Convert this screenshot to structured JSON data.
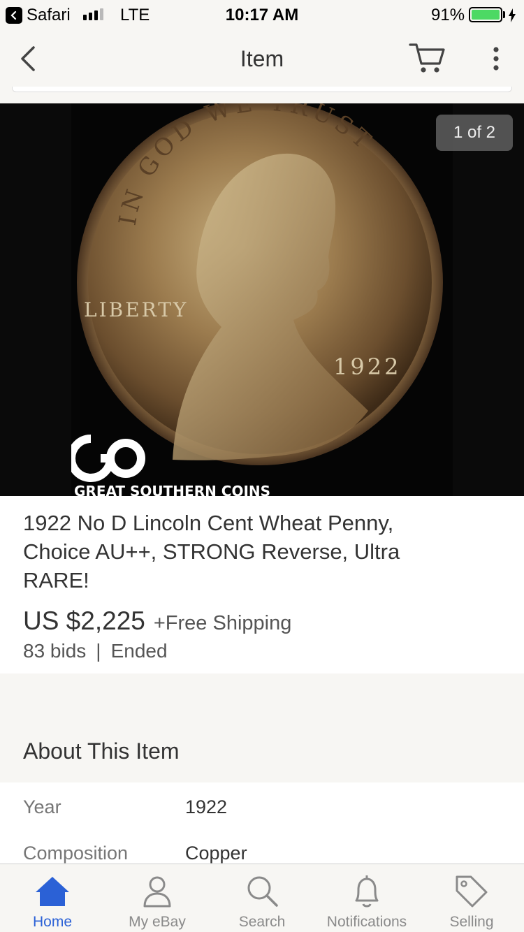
{
  "status_bar": {
    "back_app": "Safari",
    "carrier": "LTE",
    "time": "10:17 AM",
    "battery_percent": "91%",
    "signal_bars": 3,
    "signal_total": 5
  },
  "nav": {
    "title": "Item",
    "icons": [
      "chevron-left-icon",
      "cart-icon",
      "more-vertical-icon"
    ]
  },
  "gallery": {
    "counter": "1 of 2",
    "watermark": "GREAT SOUTHERN COINS",
    "coin_date": "1922",
    "coin_legend": "IN GOD WE TRUST",
    "coin_liberty": "LIBERTY"
  },
  "item": {
    "title": "1922 No D Lincoln Cent Wheat Penny, Choice AU++, STRONG Reverse, Ultra RARE!",
    "price": "US $2,225",
    "shipping": "+Free Shipping",
    "bids": "83 bids",
    "separator": "|",
    "status": "Ended"
  },
  "about": {
    "heading": "About This Item",
    "specs": [
      {
        "name": "Year",
        "value": "1922"
      },
      {
        "name": "Composition",
        "value": "Copper"
      }
    ]
  },
  "tab_bar": {
    "tabs": [
      {
        "label": "Home",
        "icon": "home-icon",
        "active": true
      },
      {
        "label": "My eBay",
        "icon": "person-icon",
        "active": false
      },
      {
        "label": "Search",
        "icon": "search-icon",
        "active": false
      },
      {
        "label": "Notifications",
        "icon": "bell-icon",
        "active": false
      },
      {
        "label": "Selling",
        "icon": "tag-icon",
        "active": false
      }
    ]
  },
  "colors": {
    "accent": "#2b61d6",
    "battery": "#4cd964",
    "background": "#f7f6f3"
  }
}
